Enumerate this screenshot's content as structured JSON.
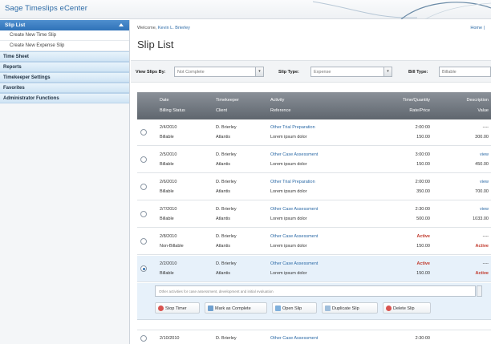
{
  "app": {
    "title": "Sage Timeslips eCenter"
  },
  "sidebar": {
    "header": "Slip List",
    "sub_items": [
      "Create New Time Slip",
      "Create New Expense Slip"
    ],
    "sections": [
      "Time Sheet",
      "Reports",
      "Timekeeper Settings",
      "Favorites",
      "Administrator Functions"
    ]
  },
  "main": {
    "welcome_prefix": "Welcome,",
    "welcome_user": "Kevin L. Brierley",
    "home_link": "Home |",
    "title": "Slip List"
  },
  "filters": {
    "view_label": "View Slips By:",
    "view_value": "Not Complete",
    "type_label": "Slip Type:",
    "type_value": "Expense",
    "bill_label": "Bill Type:",
    "bill_value": "Billable"
  },
  "table": {
    "headers": {
      "date": "Date",
      "billing_status": "Billing Status",
      "timekeeper": "Timekeeper",
      "client": "Client",
      "activity": "Activity",
      "reference": "Reference",
      "time_quantity": "Time/Quantity",
      "rate_price": "Rate/Price",
      "description": "Description",
      "value": "Value"
    },
    "rows": [
      {
        "date": "2/4/2010",
        "status": "Billable",
        "tk": "D. Brierley",
        "client": "Atlantis",
        "activity": "Other Trial Preparation",
        "ref": "Lorem ipsum dolor",
        "qty": "2:00:00",
        "rate": "150.00",
        "desc": "----",
        "value": "300.00",
        "selected": false
      },
      {
        "date": "2/5/2010",
        "status": "Billable",
        "tk": "D. Brierley",
        "client": "Atlantis",
        "activity": "Other Case Assessment",
        "ref": "Lorem ipsum dolor",
        "qty": "3:00:00",
        "rate": "150.00",
        "desc": "view",
        "value": "450.00",
        "selected": false
      },
      {
        "date": "2/6/2010",
        "status": "Billable",
        "tk": "D. Brierley",
        "client": "Atlantis",
        "activity": "Other Trial Preparation",
        "ref": "Lorem ipsum dolor",
        "qty": "2:00:00",
        "rate": "350.00",
        "desc": "view",
        "value": "700.00",
        "selected": false
      },
      {
        "date": "2/7/2010",
        "status": "Billable",
        "tk": "D. Brierley",
        "client": "Atlantis",
        "activity": "Other Case Assessment",
        "ref": "Lorem ipsum dolor",
        "qty": "2:30:00",
        "rate": "500.00",
        "desc": "view",
        "value": "1033.00",
        "selected": false
      },
      {
        "date": "2/8/2010",
        "status": "Non-Billable",
        "tk": "D. Brierley",
        "client": "Atlantis",
        "activity": "Other Case Assessment",
        "ref": "Lorem ipsum dolor",
        "qty": "Active",
        "rate": "150.00",
        "desc": "----",
        "value": "Active",
        "selected": false
      },
      {
        "date": "2/2/2010",
        "status": "Billable",
        "tk": "D. Brierley",
        "client": "Atlantis",
        "activity": "Other Case Assessment",
        "ref": "Lorem ipsum dolor",
        "qty": "Active",
        "rate": "150.00",
        "desc": "----",
        "value": "Active",
        "selected": true
      }
    ],
    "detail_note": "Other activities for case assessment, development and initial evaluation",
    "last_row": {
      "date": "2/10/2010",
      "tk": "D. Brierley",
      "activity": "Other Case Assessment",
      "qty": "2:30:00"
    }
  },
  "actions": {
    "stop_timer": "Stop Timer",
    "mark_complete": "Mark as Complete",
    "open_slip": "Open Slip",
    "duplicate_slip": "Duplicate Slip",
    "delete_slip": "Delete Slip"
  },
  "colors": {
    "accent": "#2f72b8",
    "link": "#2c6aa6",
    "alert": "#c0392b"
  }
}
